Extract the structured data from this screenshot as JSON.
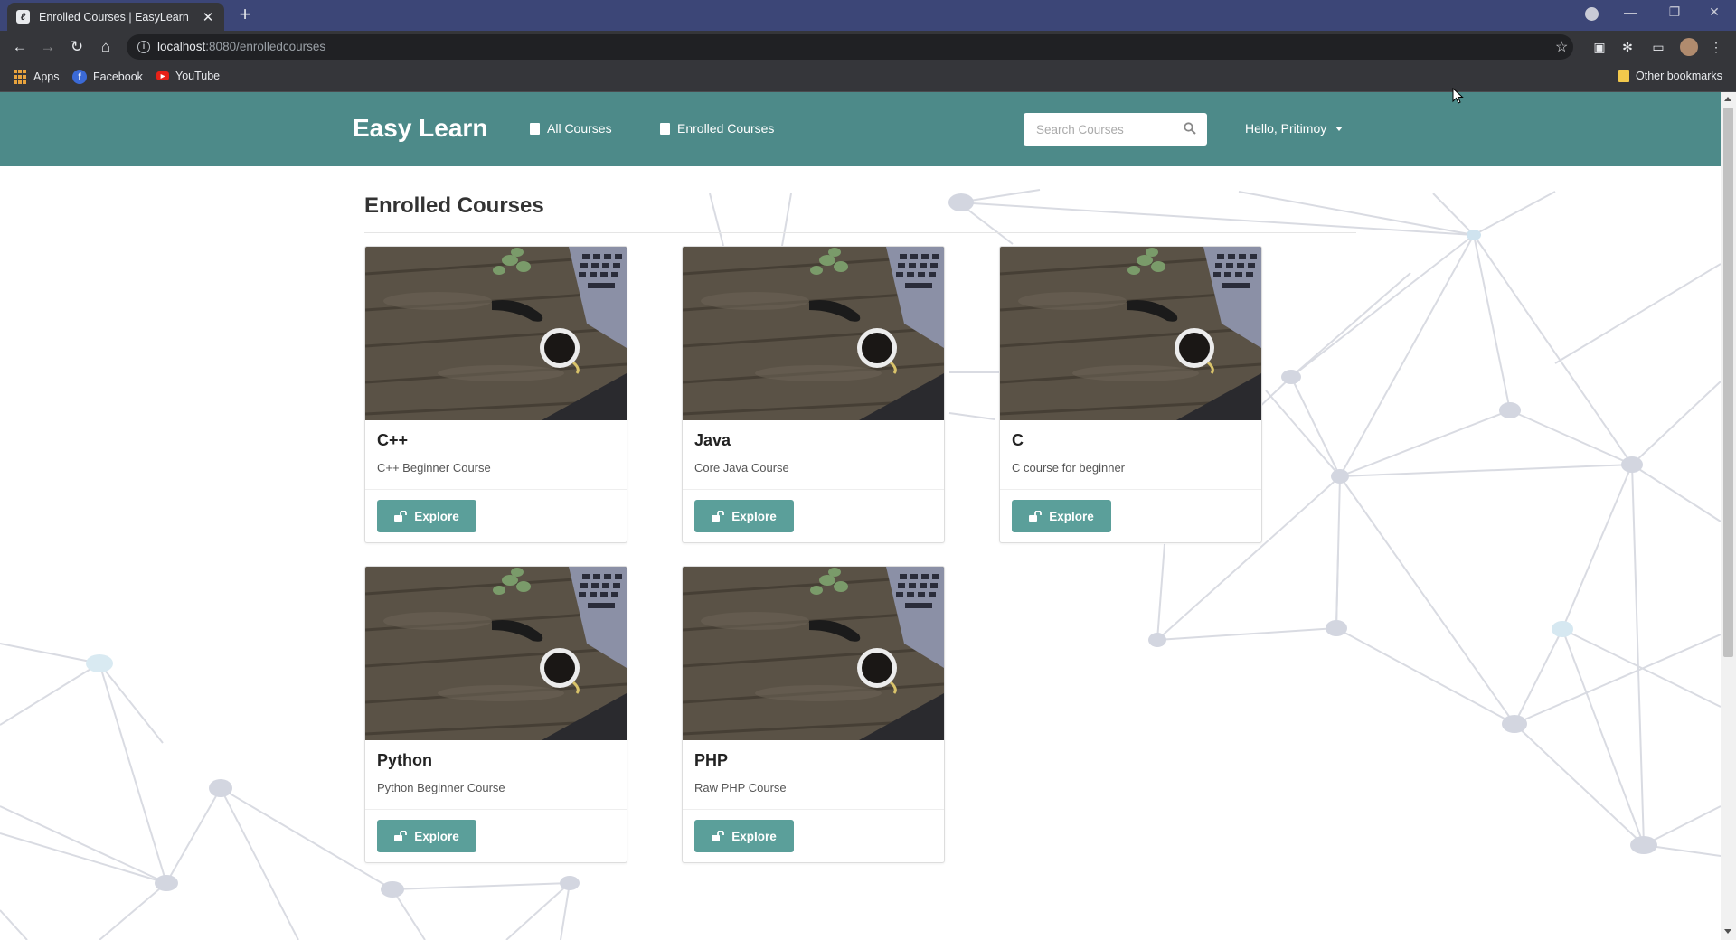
{
  "browser": {
    "tab_title": "Enrolled Courses | EasyLearn",
    "url_host": "localhost",
    "url_path": ":8080/enrolledcourses",
    "bookmarks": [
      "Apps",
      "Facebook",
      "YouTube"
    ],
    "other_bookmarks": "Other bookmarks"
  },
  "navbar": {
    "brand": "Easy Learn",
    "all_courses": "All Courses",
    "enrolled_courses": "Enrolled Courses",
    "search_placeholder": "Search Courses",
    "user_greeting": "Hello, Pritimoy"
  },
  "page": {
    "title": "Enrolled Courses"
  },
  "courses": [
    {
      "title": "C++",
      "description": "C++ Beginner Course",
      "button": "Explore"
    },
    {
      "title": "Java",
      "description": "Core Java Course",
      "button": "Explore"
    },
    {
      "title": "C",
      "description": "C course for beginner",
      "button": "Explore"
    },
    {
      "title": "Python",
      "description": "Python Beginner Course",
      "button": "Explore"
    },
    {
      "title": "PHP",
      "description": "Raw PHP Course",
      "button": "Explore"
    }
  ],
  "colors": {
    "navbar": "#4d8a89",
    "button": "#5b9f9a",
    "tabstrip": "#3c4677"
  }
}
